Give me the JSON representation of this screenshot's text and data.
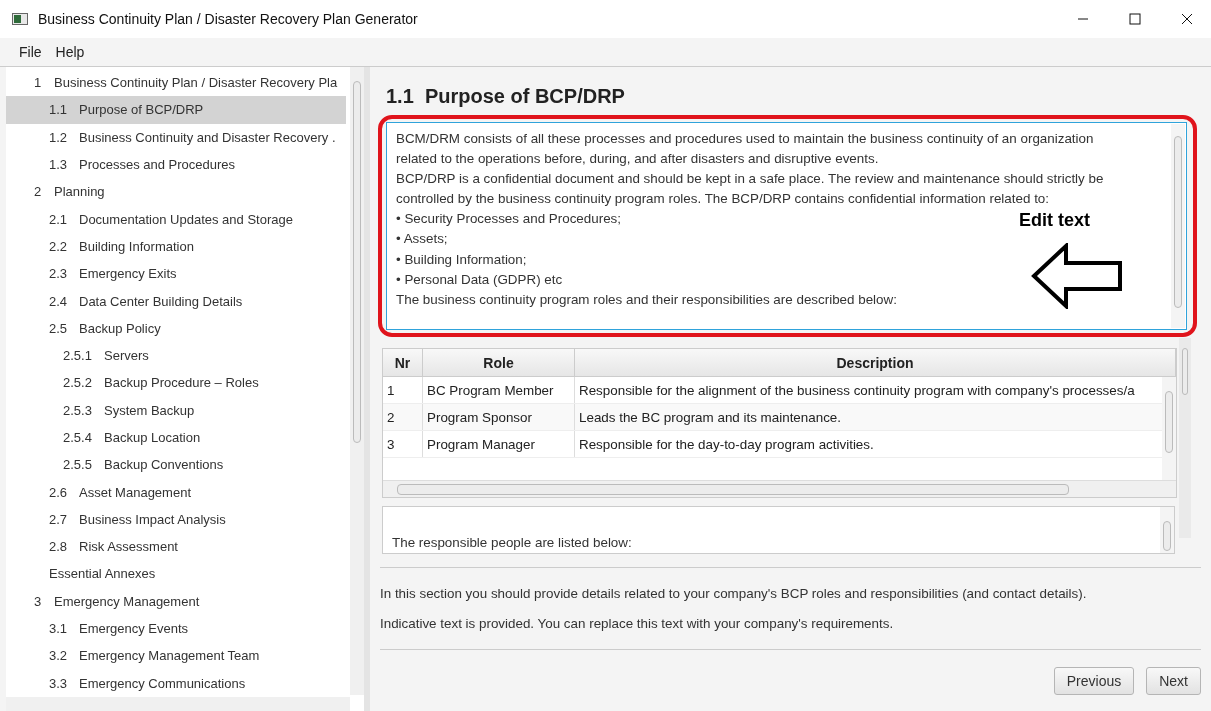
{
  "window": {
    "title": "Business Continuity Plan / Disaster Recovery Plan Generator"
  },
  "menu": [
    "File",
    "Help"
  ],
  "tree": [
    {
      "number": "1",
      "label": "Business Continuity Plan / Disaster Recovery Pla",
      "selected": false,
      "children": [
        {
          "number": "1.1",
          "label": "Purpose of BCP/DRP",
          "selected": true
        },
        {
          "number": "1.2",
          "label": "Business Continuity and Disaster Recovery .",
          "selected": false
        },
        {
          "number": "1.3",
          "label": "Processes and Procedures",
          "selected": false
        }
      ]
    },
    {
      "number": "2",
      "label": "Planning",
      "selected": false,
      "children": [
        {
          "number": "2.1",
          "label": "Documentation Updates and Storage",
          "selected": false
        },
        {
          "number": "2.2",
          "label": "Building Information",
          "selected": false
        },
        {
          "number": "2.3",
          "label": "Emergency Exits",
          "selected": false
        },
        {
          "number": "2.4",
          "label": "Data Center Building Details",
          "selected": false
        },
        {
          "number": "2.5",
          "label": "Backup Policy",
          "selected": false,
          "children": [
            {
              "number": "2.5.1",
              "label": "Servers",
              "selected": false
            },
            {
              "number": "2.5.2",
              "label": "Backup Procedure – Roles",
              "selected": false
            },
            {
              "number": "2.5.3",
              "label": "System Backup",
              "selected": false
            },
            {
              "number": "2.5.4",
              "label": "Backup Location",
              "selected": false
            },
            {
              "number": "2.5.5",
              "label": "Backup Conventions",
              "selected": false
            }
          ]
        },
        {
          "number": "2.6",
          "label": "Asset Management",
          "selected": false
        },
        {
          "number": "2.7",
          "label": "Business Impact Analysis",
          "selected": false
        },
        {
          "number": "2.8",
          "label": "Risk Assessment",
          "selected": false
        },
        {
          "label": "Essential Annexes",
          "selected": false
        }
      ]
    },
    {
      "number": "3",
      "label": "Emergency Management",
      "selected": false,
      "children": [
        {
          "number": "3.1",
          "label": "Emergency Events",
          "selected": false
        },
        {
          "number": "3.2",
          "label": "Emergency Management Team",
          "selected": false
        },
        {
          "number": "3.3",
          "label": "Emergency Communications",
          "selected": false
        }
      ]
    }
  ],
  "section": {
    "number": "1.1",
    "title": "Purpose of BCP/DRP"
  },
  "editor": {
    "value": "BCM/DRM consists of all these processes and procedures used to maintain the business continuity of an organization\nrelated to the operations before, during, and after disasters and disruptive events.\nBCP/DRP is a confidential document and should be kept in a safe place. The review and maintenance should strictly be\ncontrolled by the business continuity program roles. The BCP/DRP contains confidential information related to:\n• Security Processes and Procedures;\n• Assets;\n• Building Information;\n• Personal Data (GDPR) etc\nThe business continuity program roles and their responsibilities are described below:"
  },
  "annotation": {
    "label": "Edit text"
  },
  "table": {
    "columns": [
      "Nr",
      "Role",
      "Description"
    ],
    "rows": [
      [
        "1",
        "BC Program Member",
        "Responsible for the alignment of the business continuity program with company's processes/a"
      ],
      [
        "2",
        "Program Sponsor",
        "Leads the BC program and its maintenance."
      ],
      [
        "3",
        "Program Manager",
        "Responsible for the day-to-day program activities."
      ]
    ]
  },
  "editor2": {
    "value": "\nThe responsible people are listed below:"
  },
  "help": [
    "In this section you should provide details related to your company's BCP roles and responsibilities (and contact details).",
    "Indicative text is provided. You can replace this text with your company's requirements."
  ],
  "buttons": [
    "Previous",
    "Next"
  ]
}
